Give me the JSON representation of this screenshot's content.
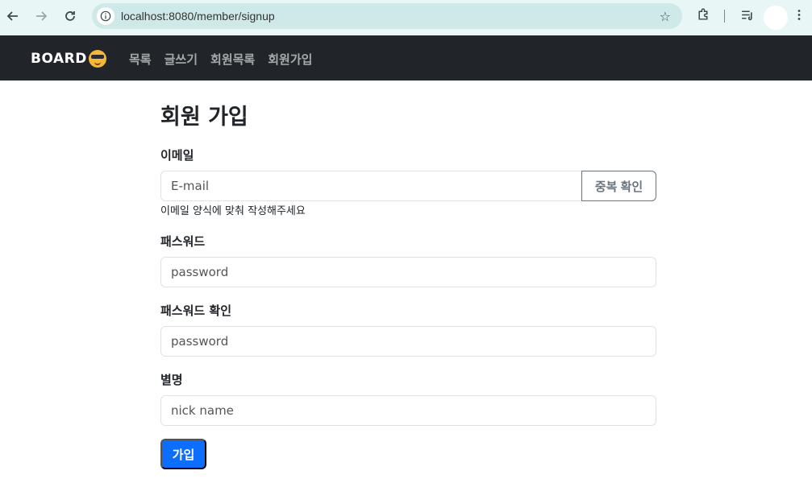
{
  "browser": {
    "url": "localhost:8080/member/signup",
    "back_icon": "arrow-left-icon",
    "forward_icon": "arrow-right-icon",
    "reload_icon": "reload-icon",
    "info_icon": "info-icon",
    "bookmark_icon": "star-icon",
    "extensions_icon": "puzzle-icon",
    "media_icon": "playlist-icon",
    "menu_icon": "kebab-menu-icon"
  },
  "navbar": {
    "brand": "BOARD",
    "brand_icon": "sunglasses-emoji-icon",
    "links": [
      "목록",
      "글쓰기",
      "회원목록",
      "회원가입"
    ]
  },
  "form": {
    "title": "회원 가입",
    "email": {
      "label": "이메일",
      "placeholder": "E-mail",
      "check_button": "중복 확인",
      "helper": "이메일 양식에 맞춰 작성해주세요"
    },
    "password": {
      "label": "패스워드",
      "placeholder": "password"
    },
    "password_confirm": {
      "label": "패스워드 확인",
      "placeholder": "password"
    },
    "nickname": {
      "label": "별명",
      "placeholder": "nick name"
    },
    "submit": "가입"
  },
  "colors": {
    "navbar_bg": "#212529",
    "primary": "#0d6efd",
    "secondary": "#6c757d",
    "chrome_bg": "#e8f6f6"
  }
}
